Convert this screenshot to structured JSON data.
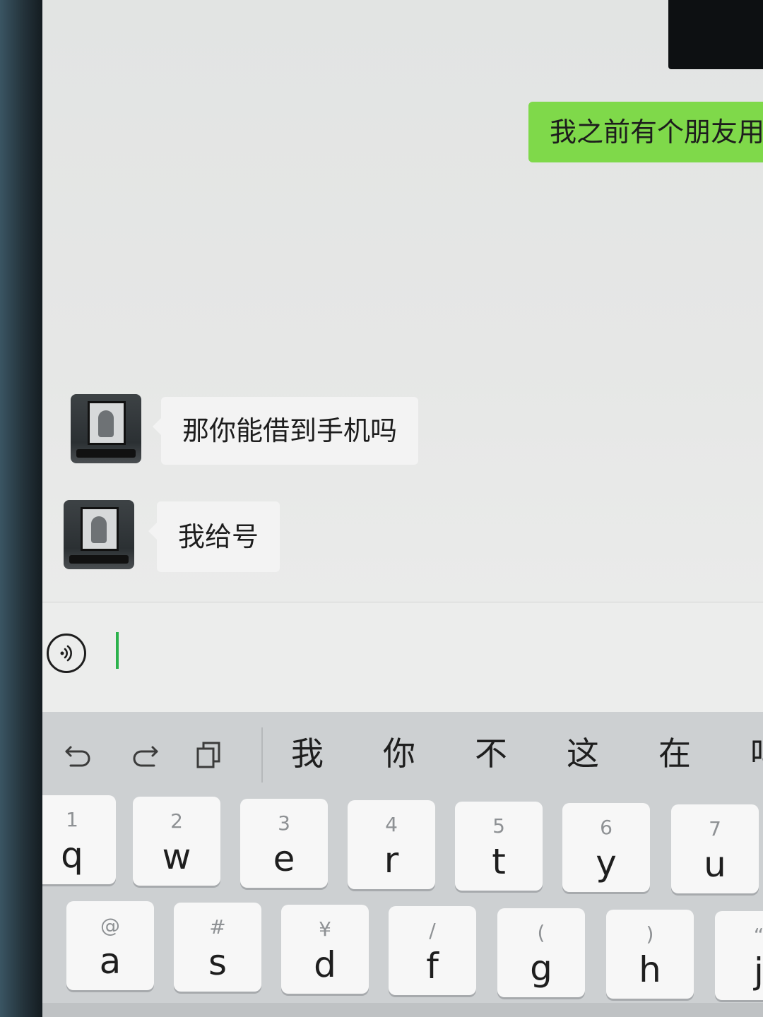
{
  "chat": {
    "outgoing_partial": "我之前有个朋友用的",
    "incoming": [
      "那你能借到手机吗",
      "我给号"
    ]
  },
  "input": {
    "voice_icon": "voice-icon",
    "placeholder": ""
  },
  "keyboard": {
    "tools": [
      "undo-icon",
      "redo-icon",
      "clipboard-icon"
    ],
    "candidates": [
      "我",
      "你",
      "不",
      "这",
      "在",
      "吗"
    ],
    "row1": [
      {
        "sub": "1",
        "main": "q"
      },
      {
        "sub": "2",
        "main": "w"
      },
      {
        "sub": "3",
        "main": "e"
      },
      {
        "sub": "4",
        "main": "r"
      },
      {
        "sub": "5",
        "main": "t"
      },
      {
        "sub": "6",
        "main": "y"
      },
      {
        "sub": "7",
        "main": "u"
      }
    ],
    "row2": [
      {
        "sub": "@",
        "main": "a"
      },
      {
        "sub": "#",
        "main": "s"
      },
      {
        "sub": "¥",
        "main": "d"
      },
      {
        "sub": "/",
        "main": "f"
      },
      {
        "sub": "(",
        "main": "g"
      },
      {
        "sub": ")",
        "main": "h"
      },
      {
        "sub": "“",
        "main": "j"
      }
    ]
  },
  "colors": {
    "outgoing_bubble": "#7fd94a",
    "incoming_bubble": "#f3f3f3",
    "caret": "#2bb24c"
  }
}
